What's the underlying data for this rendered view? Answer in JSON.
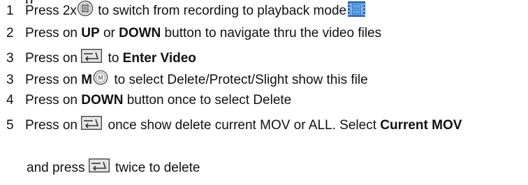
{
  "top_fragment": "p",
  "steps": [
    {
      "number": "1",
      "a": "Press 2x",
      "b": " to switch from recording to playback mode",
      "icons": [
        "menu-button-icon",
        "video-film-icon"
      ]
    },
    {
      "number": "2",
      "a": "Press on ",
      "bold1": "UP",
      "b": " or ",
      "bold2": "DOWN",
      "c": " button to navigate thru the video files"
    },
    {
      "number": "3",
      "a": "Press on ",
      "b": " to ",
      "bold1": "Enter Video",
      "icons": [
        "enter-button-icon"
      ]
    },
    {
      "number": "3",
      "a": "Press on ",
      "bold1": "M",
      "b": " to select Delete/Protect/Slight show this file",
      "icons": [
        "m-button-icon"
      ]
    },
    {
      "number": "4",
      "a": "Press on ",
      "bold1": "DOWN",
      "b": " button once to select Delete"
    },
    {
      "number": "5",
      "a": "Press on ",
      "b": " once show delete current MOV or ALL. Select ",
      "bold1": "Current MOV",
      "icons": [
        "enter-button-icon"
      ],
      "continuation": {
        "a": "and press ",
        "b": " twice to delete"
      }
    }
  ],
  "colors": {
    "text": "#111111",
    "icon_gray": "#e6e6e6",
    "icon_outline": "#444444",
    "film_blue": "#2a7fd0",
    "film_frame": "#1d4f9a"
  }
}
